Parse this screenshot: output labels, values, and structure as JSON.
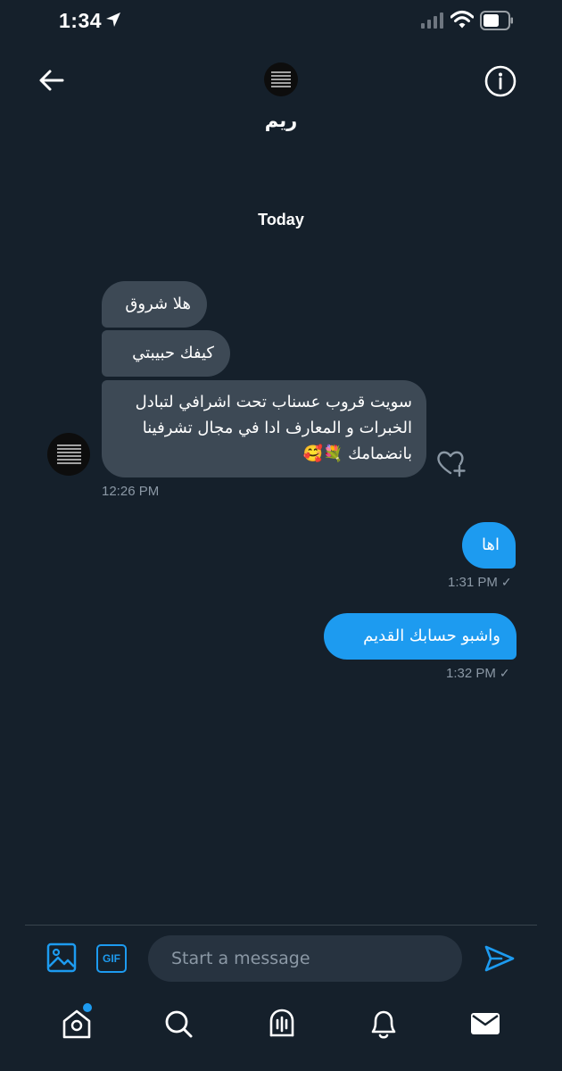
{
  "status_bar": {
    "time": "1:34",
    "icons": [
      "location-arrow-icon",
      "cellular-signal-icon",
      "wifi-icon",
      "battery-icon"
    ]
  },
  "header": {
    "back_icon": "arrow-left-icon",
    "contact_name": "ريم",
    "info_icon": "info-circle-icon"
  },
  "conversation": {
    "date_separator": "Today",
    "messages": [
      {
        "direction": "received",
        "text": "هلا شروق"
      },
      {
        "direction": "received",
        "text": "كيفك حبيبتي"
      },
      {
        "direction": "received",
        "text": "سويت قروب عسناب تحت اشرافي لتبادل الخبرات و المعارف ادا في مجال تشرفينا بانضمامك 💐🥰",
        "time": "12:26 PM"
      },
      {
        "direction": "sent",
        "text": "اها",
        "time": "1:31 PM",
        "status": "✓"
      },
      {
        "direction": "sent",
        "text": "واشبو حسابك القديم",
        "time": "1:32 PM",
        "status": "✓"
      }
    ]
  },
  "composer": {
    "placeholder": "Start a message",
    "gif_label": "GIF",
    "image_icon": "image-icon",
    "send_icon": "send-icon"
  },
  "tabbar": {
    "items": [
      "home-icon",
      "search-icon",
      "spaces-icon",
      "notifications-icon",
      "messages-icon"
    ],
    "home_has_badge": true
  },
  "colors": {
    "background": "#15202b",
    "received_bubble": "#3d4955",
    "sent_bubble": "#1d9bf0",
    "muted_text": "#8b98a5",
    "accent": "#1d9bf0"
  }
}
